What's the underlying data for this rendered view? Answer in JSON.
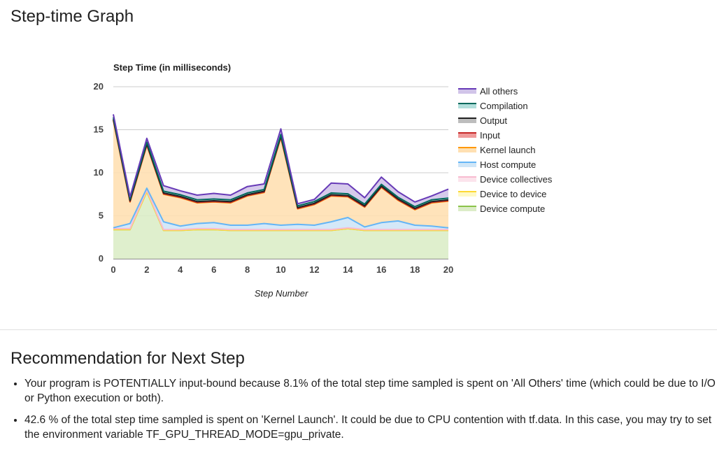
{
  "page": {
    "title": "Step-time Graph",
    "recommendation_title": "Recommendation for Next Step",
    "recommendations": [
      "Your program is POTENTIALLY input-bound because 8.1% of the total step time sampled is spent on 'All Others' time (which could be due to I/O or Python execution or both).",
      "42.6 % of the total step time sampled is spent on 'Kernel Launch'. It could be due to CPU contention with tf.data. In this case, you may try to set the environment variable TF_GPU_THREAD_MODE=gpu_private."
    ]
  },
  "chart_data": {
    "type": "area",
    "stacked": true,
    "title": "Step Time (in milliseconds)",
    "xlabel": "Step Number",
    "ylabel": "",
    "xlim": [
      0,
      20
    ],
    "ylim": [
      0,
      20
    ],
    "x_ticks": [
      0,
      2,
      4,
      6,
      8,
      10,
      12,
      14,
      16,
      18,
      20
    ],
    "y_ticks": [
      0,
      5,
      10,
      15,
      20
    ],
    "grid": true,
    "legend_position": "right",
    "x": [
      0,
      1,
      2,
      3,
      4,
      5,
      6,
      7,
      8,
      9,
      10,
      11,
      12,
      13,
      14,
      15,
      16,
      17,
      18,
      19,
      20
    ],
    "series": [
      {
        "name": "Device compute",
        "fill": "#dcedc8",
        "stroke": "#8bc34a",
        "values": [
          3.4,
          3.4,
          7.8,
          3.3,
          3.3,
          3.4,
          3.4,
          3.3,
          3.3,
          3.3,
          3.3,
          3.3,
          3.3,
          3.3,
          3.5,
          3.3,
          3.3,
          3.3,
          3.3,
          3.3,
          3.3
        ]
      },
      {
        "name": "Device to device",
        "fill": "#fff9c4",
        "stroke": "#fdd835",
        "values": [
          0,
          0,
          0,
          0,
          0,
          0,
          0,
          0,
          0,
          0,
          0,
          0,
          0,
          0,
          0,
          0,
          0,
          0,
          0,
          0,
          0
        ]
      },
      {
        "name": "Device collectives",
        "fill": "#fce4ec",
        "stroke": "#f8bbd0",
        "values": [
          0.1,
          0.1,
          0.2,
          0.1,
          0.1,
          0.1,
          0.1,
          0.1,
          0.1,
          0.1,
          0.1,
          0.1,
          0.1,
          0.1,
          0.1,
          0.1,
          0.1,
          0.1,
          0.1,
          0.1,
          0.1
        ]
      },
      {
        "name": "Host compute",
        "fill": "#cfe6f7",
        "stroke": "#64b5f6",
        "values": [
          0.1,
          0.6,
          0.2,
          0.9,
          0.4,
          0.6,
          0.7,
          0.5,
          0.5,
          0.7,
          0.5,
          0.6,
          0.5,
          0.9,
          1.2,
          0.3,
          0.8,
          1.0,
          0.5,
          0.4,
          0.2
        ]
      },
      {
        "name": "Kernel launch",
        "fill": "#ffe0b2",
        "stroke": "#ff9800",
        "values": [
          12.5,
          2.5,
          5.0,
          3.2,
          3.3,
          2.4,
          2.4,
          2.6,
          3.4,
          3.6,
          10.2,
          1.8,
          2.4,
          3.0,
          2.4,
          2.3,
          4.1,
          2.4,
          1.8,
          2.7,
          3.1
        ]
      },
      {
        "name": "Input",
        "fill": "#ef9a9a",
        "stroke": "#c62828",
        "values": [
          0.05,
          0.05,
          0.05,
          0.05,
          0.05,
          0.05,
          0.05,
          0.05,
          0.05,
          0.05,
          0.05,
          0.05,
          0.05,
          0.05,
          0.05,
          0.05,
          0.05,
          0.05,
          0.05,
          0.05,
          0.05
        ]
      },
      {
        "name": "Output",
        "fill": "#bdbdbd",
        "stroke": "#212121",
        "values": [
          0.1,
          0.1,
          0.1,
          0.1,
          0.1,
          0.1,
          0.1,
          0.1,
          0.1,
          0.1,
          0.1,
          0.1,
          0.1,
          0.1,
          0.1,
          0.1,
          0.1,
          0.1,
          0.1,
          0.1,
          0.1
        ]
      },
      {
        "name": "Compilation",
        "fill": "#b2dfdb",
        "stroke": "#00695c",
        "values": [
          0.2,
          0.2,
          0.2,
          0.2,
          0.2,
          0.2,
          0.2,
          0.2,
          0.2,
          0.2,
          0.2,
          0.2,
          0.2,
          0.2,
          0.2,
          0.2,
          0.2,
          0.2,
          0.2,
          0.2,
          0.2
        ]
      },
      {
        "name": "All others",
        "fill": "#d1c4e9",
        "stroke": "#673ab7",
        "values": [
          0.35,
          0.25,
          0.45,
          0.65,
          0.45,
          0.55,
          0.65,
          0.55,
          0.75,
          0.65,
          0.65,
          0.25,
          0.25,
          1.15,
          1.15,
          0.75,
          0.85,
          0.65,
          0.55,
          0.45,
          1.05
        ]
      }
    ]
  }
}
